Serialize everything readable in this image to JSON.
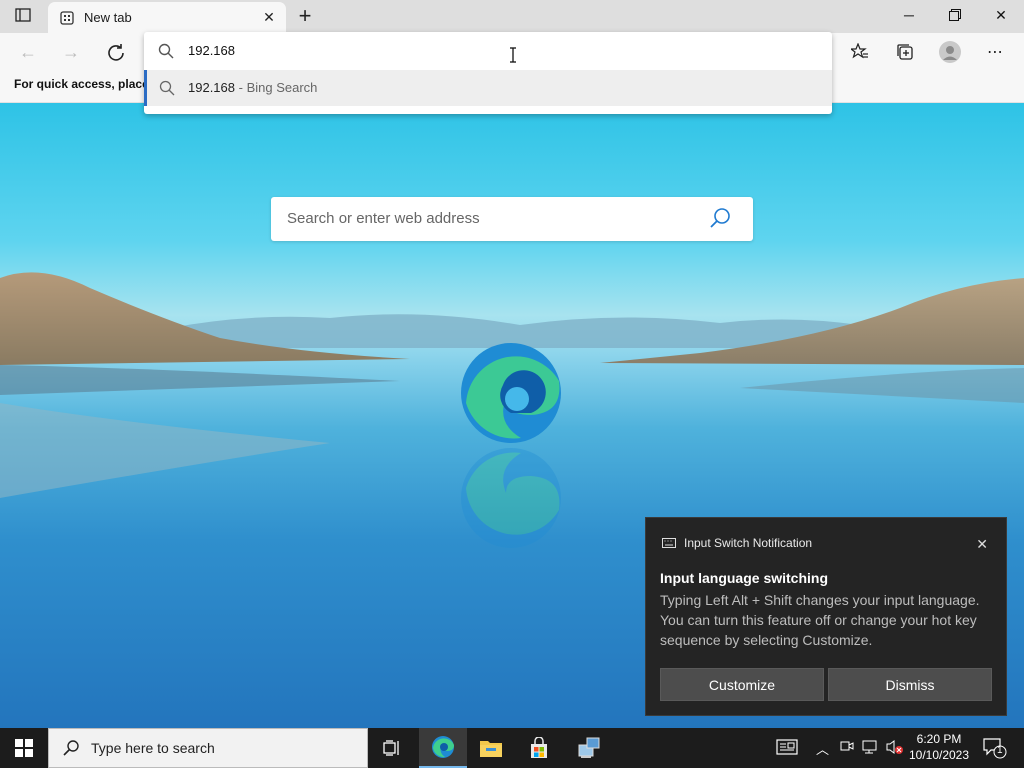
{
  "browser": {
    "tab_title": "New tab",
    "address_value": "192.168",
    "suggestion": {
      "query": "192.168",
      "separator": " - ",
      "provider": "Bing Search"
    },
    "favorites_hint": "For quick access, place y"
  },
  "ntp": {
    "search_placeholder": "Search or enter web address"
  },
  "notification": {
    "app_name": "Input Switch Notification",
    "title": "Input language switching",
    "body": "Typing Left Alt + Shift changes your input language. You can turn this feature off or change your hot key sequence by selecting Customize.",
    "customize_label": "Customize",
    "dismiss_label": "Dismiss"
  },
  "taskbar": {
    "search_placeholder": "Type here to search",
    "time": "6:20 PM",
    "date": "10/10/2023",
    "notification_count": "1"
  },
  "colors": {
    "accent": "#2b6cc4",
    "taskbar": "#1c1c1c",
    "toast_bg": "#242424"
  }
}
